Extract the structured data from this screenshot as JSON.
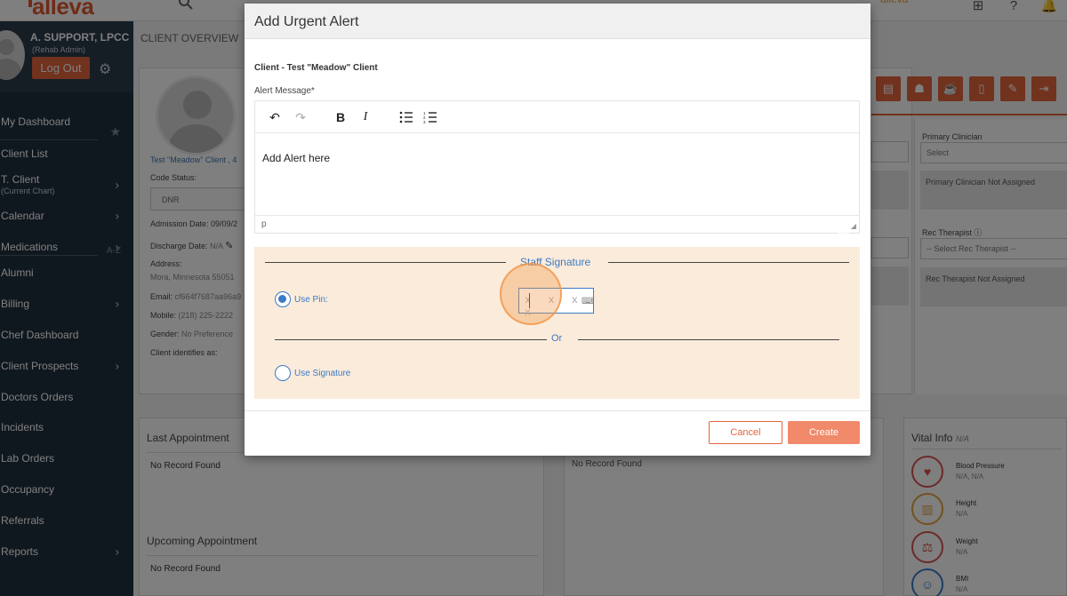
{
  "app": {
    "logo": "alleva",
    "brand_badge": "alleva"
  },
  "user": {
    "name": "A. SUPPORT, LPCC",
    "role": "(Rehab Admin)",
    "logout_label": "Log Out"
  },
  "nav": [
    {
      "label": "My Dashboard",
      "chevron": false
    },
    {
      "label": "Client List",
      "chevron": false
    },
    {
      "label": "T. Client",
      "sub": "(Current Chart)",
      "chevron": true
    },
    {
      "label": "Calendar",
      "chevron": true
    },
    {
      "label": "Medications",
      "chevron": true
    },
    {
      "label": "Alumni",
      "chevron": false
    },
    {
      "label": "Billing",
      "chevron": true
    },
    {
      "label": "Chef Dashboard",
      "chevron": false
    },
    {
      "label": "Client Prospects",
      "chevron": true
    },
    {
      "label": "Doctors Orders",
      "chevron": false
    },
    {
      "label": "Incidents",
      "chevron": false
    },
    {
      "label": "Lab Orders",
      "chevron": false
    },
    {
      "label": "Occupancy",
      "chevron": false
    },
    {
      "label": "Referrals",
      "chevron": false
    },
    {
      "label": "Reports",
      "chevron": true
    }
  ],
  "nav_az": "A-Z",
  "main": {
    "breadcrumb": "CLIENT OVERVIEW",
    "client": {
      "name_link": "Test \"Meadow\" Client ,  4",
      "code_status_label": "Code Status:",
      "code_status_value": "DNR",
      "admission": "Admission Date: 09/09/2",
      "discharge_label": "Discharge Date: ",
      "discharge_value": "N/A",
      "address_label": "Address:",
      "address_value": "Mora,  Minnesota  55051",
      "email_label": "Email: ",
      "email_value": "cf664f7687aa96a9",
      "mobile_label": "Mobile: ",
      "mobile_value": "(218) 225-2222",
      "gender_label": "Gender: ",
      "gender_value": "No Preference",
      "identifies_label": "Client identifies as:"
    },
    "right_panel": {
      "primary_clinician_label": "Primary Clinician",
      "primary_clinician_select": "Select",
      "primary_clinician_note": "Primary Clinician Not Assigned",
      "rec_therapist_label": "Rec Therapist",
      "rec_therapist_select": "-- Select Rec Therapist --",
      "rec_therapist_note": "Rec Therapist Not Assigned"
    },
    "last_appointment": {
      "title": "Last Appointment",
      "empty": "No Record Found"
    },
    "upcoming_appointment": {
      "title": "Upcoming Appointment",
      "empty": "No Record Found"
    },
    "middle_panel": {
      "empty": "No Record Found"
    },
    "vitals": {
      "title": "Vital Info",
      "title_suffix": "N/A",
      "items": [
        {
          "label": "Blood Pressure",
          "value": "N/A, N/A",
          "icon": "heart-icon",
          "color": "#d9534f"
        },
        {
          "label": "Height",
          "value": "N/A",
          "icon": "ruler-icon",
          "color": "#e6a23c"
        },
        {
          "label": "Weight",
          "value": "N/A",
          "icon": "scale-icon",
          "color": "#d9534f"
        },
        {
          "label": "BMI",
          "value": "N/A",
          "icon": "body-icon",
          "color": "#3b7bc4"
        }
      ]
    }
  },
  "modal": {
    "title": "Add Urgent Alert",
    "client_line": "Client - Test \"Meadow\" Client",
    "alert_label": "Alert Message*",
    "editor_content": "Add Alert here",
    "editor_status": "p",
    "toolbar": [
      "undo-icon",
      "redo-icon",
      "bold-icon",
      "italic-icon",
      "bullet-list-icon",
      "numbered-list-icon"
    ],
    "signature": {
      "title": "Staff Signature",
      "use_pin_label": "Use Pin:",
      "pin_placeholder": "x x x x",
      "or_label": "Or",
      "use_signature_label": "Use Signature",
      "selected": "pin"
    },
    "cancel_label": "Cancel",
    "create_label": "Create"
  },
  "colors": {
    "accent": "#e3643d",
    "link": "#3b7bc4",
    "sidebar": "#21303f",
    "signature_bg": "#fbebdb"
  }
}
